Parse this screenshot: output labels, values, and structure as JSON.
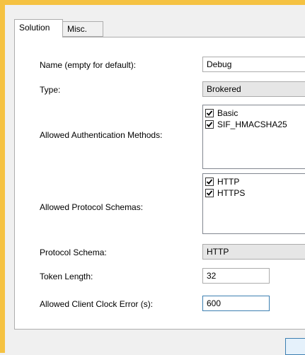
{
  "tabs": [
    {
      "label": "Solution",
      "active": true
    },
    {
      "label": "Misc.",
      "active": false
    }
  ],
  "form": {
    "name": {
      "label": "Name (empty for default):",
      "value": "Debug"
    },
    "type": {
      "label": "Type:",
      "value": "Brokered"
    },
    "auth_methods": {
      "label": "Allowed Authentication Methods:",
      "items": [
        {
          "label": "Basic",
          "checked": true
        },
        {
          "label": "SIF_HMACSHA25",
          "checked": true
        }
      ]
    },
    "protocol_schemas": {
      "label": "Allowed Protocol Schemas:",
      "items": [
        {
          "label": "HTTP",
          "checked": true
        },
        {
          "label": "HTTPS",
          "checked": true
        }
      ]
    },
    "protocol_schema": {
      "label": "Protocol Schema:",
      "value": "HTTP"
    },
    "token_length": {
      "label": "Token Length:",
      "value": "32"
    },
    "clock_error": {
      "label": "Allowed Client Clock Error (s):",
      "value": "600"
    }
  },
  "colors": {
    "window_border": "#f5c242",
    "focus_border": "#3c7fb1"
  }
}
